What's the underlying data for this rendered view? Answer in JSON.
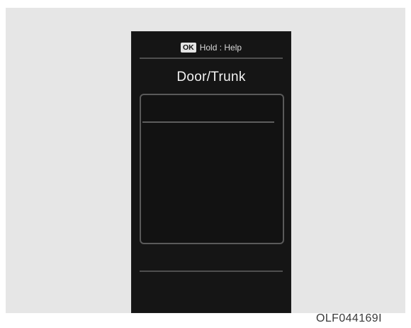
{
  "display": {
    "header": {
      "ok_badge": "OK",
      "hold_help_text": "Hold : Help"
    },
    "title": "Door/Trunk"
  },
  "figure_code": "OLF044169I"
}
